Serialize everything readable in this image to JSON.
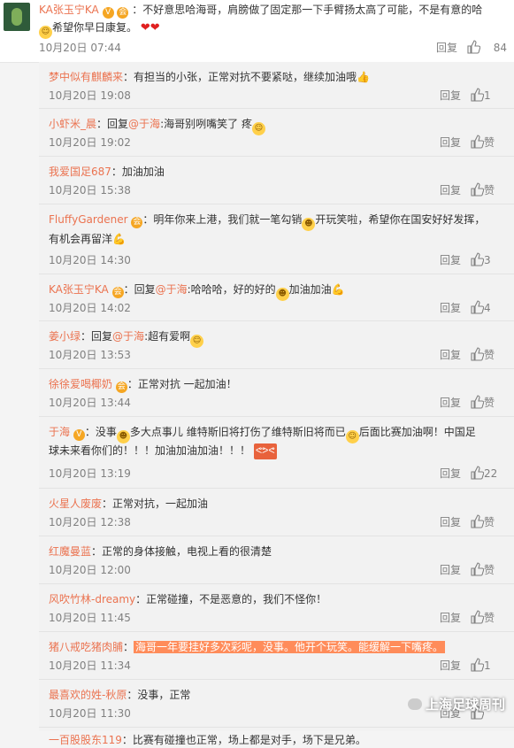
{
  "top": {
    "user": "KA张玉宁KA",
    "sep": "：",
    "text1": "不好意思哈海哥，肩膀做了固定那一下手臂扬太高了可能，不是有意的哈",
    "text2": "希望你早日康复。",
    "time": "10月20日 07:44",
    "reply_label": "回复",
    "like_count": "84"
  },
  "replies": [
    {
      "user": "梦中似有麒麟来",
      "text": "有担当的小张，正常对抗不要紧哒，继续加油哦",
      "time": "10月20日 19:08",
      "reply_label": "回复",
      "like": "1"
    },
    {
      "user": "小虾米_晨",
      "pre": "回复",
      "mention": "@于海",
      "text": ":海哥别咧嘴笑了 疼",
      "time": "10月20日 19:02",
      "reply_label": "回复",
      "like": "赞"
    },
    {
      "user": "我爱国足687",
      "text": "加油加油",
      "time": "10月20日 15:38",
      "reply_label": "回复",
      "like": "赞"
    },
    {
      "user": "FluffyGardener",
      "text1": "明年你来上港，我们就一笔勾销",
      "text1b": "开玩笑啦，希望你在国安好好发挥，",
      "text2": "有机会再留洋",
      "time": "10月20日 14:30",
      "reply_label": "回复",
      "like": "3"
    },
    {
      "user": "KA张玉宁KA",
      "pre": "回复",
      "mention": "@于海",
      "text": ":哈哈哈，好的好的",
      "text_b": "加油加油",
      "time": "10月20日 14:02",
      "reply_label": "回复",
      "like": "4"
    },
    {
      "user": "姜小绿",
      "pre": "回复",
      "mention": "@于海",
      "text": ":超有爱啊",
      "time": "10月20日 13:53",
      "reply_label": "回复",
      "like": "赞"
    },
    {
      "user": "徐徐爱喝椰奶",
      "text": "正常对抗 一起加油！",
      "time": "10月20日 13:44",
      "reply_label": "回复",
      "like": "赞"
    },
    {
      "user": "于海",
      "text1": "没事",
      "text1b": "多大点事儿 维特斯旧将打伤了维特斯旧将而已",
      "text1c": "后面比赛加油啊！中国足",
      "text2": "球未来看你们的！！！加油加油加油！！！",
      "time": "10月20日 13:19",
      "reply_label": "回复",
      "like": "22"
    },
    {
      "user": "火星人废废",
      "text": "正常对抗，一起加油",
      "time": "10月20日 12:38",
      "reply_label": "回复",
      "like": "赞"
    },
    {
      "user": "红魔曼蓝",
      "text": "正常的身体接触，电视上看的很清楚",
      "time": "10月20日 12:00",
      "reply_label": "回复",
      "like": "赞"
    },
    {
      "user": "风吹竹林-dreamy",
      "text": "正常碰撞，不是恶意的，我们不怪你！",
      "time": "10月20日 11:45",
      "reply_label": "回复",
      "like": "赞"
    },
    {
      "user": "猪八戒吃猪肉脯",
      "text": "海哥一年要挂好多次彩呢，没事。他开个玩笑。能缓解一下嘴疼。",
      "time": "10月20日 11:34",
      "reply_label": "回复",
      "like": "1"
    },
    {
      "user": "最喜欢的姓-秋原",
      "text": "没事，正常",
      "time": "10月20日 11:30",
      "reply_label": "回复",
      "like": ""
    },
    {
      "user": "一百股股东119",
      "text": "比赛有碰撞也正常，场上都是对手，场下是兄弟。"
    }
  ],
  "watermark": "上海足球周刊",
  "colors": {
    "username": "#eb7350",
    "highlight": "#ff8c5a",
    "background": "#f2f2f2"
  }
}
